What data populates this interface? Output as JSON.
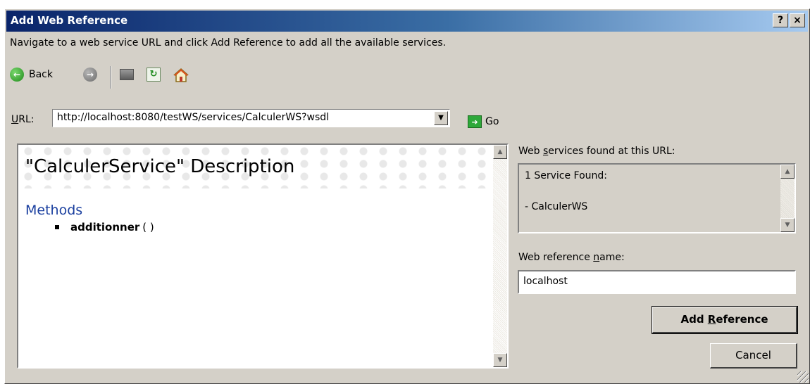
{
  "window": {
    "title": "Add Web Reference"
  },
  "titlebar": {
    "help_label": "?",
    "close_label": "×"
  },
  "instructions": "Navigate to a web service URL and click Add Reference to add all the available services.",
  "toolbar": {
    "back_label": "Back",
    "back_icon": "back-arrow-icon",
    "forward_icon": "forward-arrow-icon",
    "stop_icon": "stop-icon",
    "refresh_icon": "refresh-icon",
    "home_icon": "home-icon"
  },
  "url": {
    "label_underlined": "U",
    "label_rest": "RL:",
    "value": "http://localhost:8080/testWS/services/CalculerWS?wsdl",
    "go_label": "Go"
  },
  "browser": {
    "service_heading": "\"CalculerService\" Description",
    "methods_heading": "Methods",
    "methods": [
      {
        "name": "additionner",
        "args": "( )"
      }
    ]
  },
  "services_found": {
    "label_pre": "Web ",
    "label_underlined": "s",
    "label_post": "ervices found at this URL:",
    "lines": [
      "1 Service Found:",
      "- CalculerWS"
    ]
  },
  "reference": {
    "label_pre": "Web reference ",
    "label_underlined": "n",
    "label_post": "ame:",
    "value": "localhost"
  },
  "buttons": {
    "add_pre": "Add ",
    "add_underlined": "R",
    "add_post": "eference",
    "cancel_label": "Cancel"
  },
  "colors": {
    "title_bar_start": "#0a246a",
    "title_bar_end": "#a6caf0",
    "methods_heading": "#1a3f9f",
    "dialog_face": "#d4d0c8"
  }
}
